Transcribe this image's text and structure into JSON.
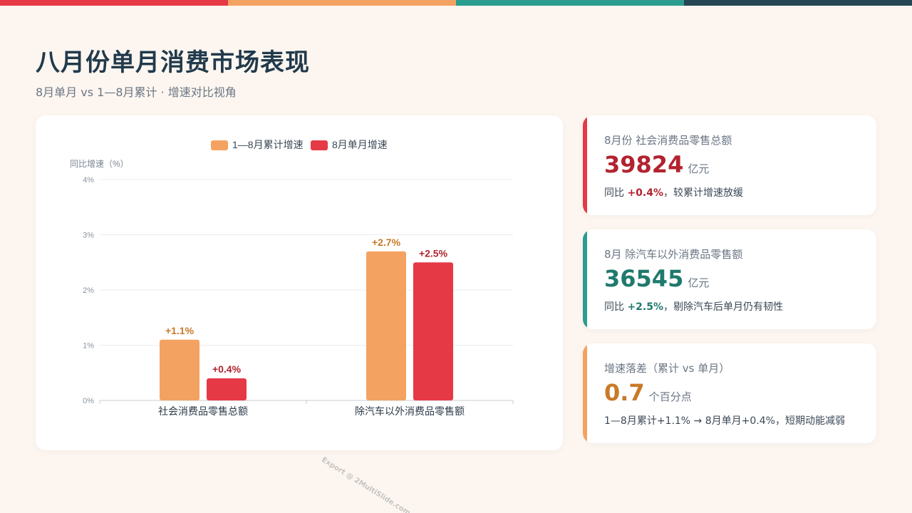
{
  "colors": {
    "bar1": "#f4a261",
    "bar2": "#e63946",
    "label1": "#c97a28",
    "label2": "#b2232f",
    "green": "#1f7a6d",
    "top": [
      "#e63946",
      "#f4a261",
      "#2a9d8f",
      "#264653"
    ]
  },
  "page": {
    "title": "八月份单月消费市场表现",
    "subtitle": "8月单月 vs 1—8月累计 · 增速对比视角"
  },
  "chart_data": {
    "type": "bar",
    "categories": [
      "社会消费品零售总额",
      "除汽车以外消费品零售额"
    ],
    "series": [
      {
        "name": "1—8月累计增速",
        "values": [
          1.1,
          2.7
        ],
        "labels": [
          "+1.1%",
          "+2.7%"
        ]
      },
      {
        "name": "8月单月增速",
        "values": [
          0.4,
          2.5
        ],
        "labels": [
          "+0.4%",
          "+2.5%"
        ]
      }
    ],
    "ylabel": "同比增速（%）",
    "ylim": [
      0,
      4
    ],
    "yticks": [
      "0%",
      "1%",
      "2%",
      "3%",
      "4%"
    ],
    "grid": true,
    "legend": "top-center"
  },
  "kpis": [
    {
      "label": "8月份 社会消费品零售总额",
      "value": "39824",
      "unit": "亿元",
      "desc_pre": "同比 ",
      "desc_hl": "+0.4%",
      "desc_post": "，较累计增速放缓",
      "color": "#e63946",
      "value_color": "#b2232f"
    },
    {
      "label": "8月 除汽车以外消费品零售额",
      "value": "36545",
      "unit": "亿元",
      "desc_pre": "同比 ",
      "desc_hl": "+2.5%",
      "desc_post": "，剔除汽车后单月仍有韧性",
      "color": "#2a9d8f",
      "value_color": "#1f7a6d"
    },
    {
      "label": "增速落差（累计 vs 单月）",
      "value": "0.7",
      "unit": "个百分点",
      "desc_pre": "1—8月累计+1.1% → 8月单月+0.4%，短期动能减弱",
      "desc_hl": "",
      "desc_post": "",
      "color": "#f4a261",
      "value_color": "#c97a28"
    }
  ],
  "watermark": "Export @ 2MultiSlide.com"
}
